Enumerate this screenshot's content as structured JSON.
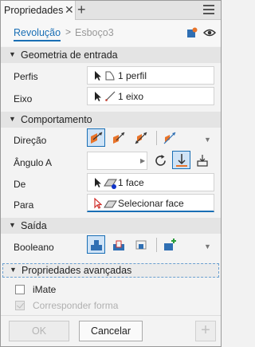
{
  "tab": {
    "label": "Propriedades",
    "close": "✕",
    "add": "+"
  },
  "breadcrumb": {
    "active": "Revolução",
    "separator": ">",
    "other": "Esboço3"
  },
  "sections": {
    "input": "Geometria de entrada",
    "behavior": "Comportamento",
    "output": "Saída",
    "advanced": "Propriedades avançadas"
  },
  "input": {
    "profiles_label": "Perfis",
    "profiles_value": "1 perfil",
    "axis_label": "Eixo",
    "axis_value": "1 eixo"
  },
  "behavior": {
    "direction_label": "Direção",
    "angle_label": "Ângulo A",
    "angle_value": "",
    "from_label": "De",
    "from_value": "1 face",
    "to_label": "Para",
    "to_value": "Selecionar face"
  },
  "output": {
    "boolean_label": "Booleano"
  },
  "advanced": {
    "imate_label": "iMate",
    "match_shape_label": "Corresponder forma"
  },
  "footer": {
    "ok_label": "OK",
    "cancel_label": "Cancelar",
    "add_label": "+"
  },
  "colors": {
    "accent": "#1a6fb5",
    "orange": "#e8742a",
    "selection_bg": "#cfe3f6"
  }
}
